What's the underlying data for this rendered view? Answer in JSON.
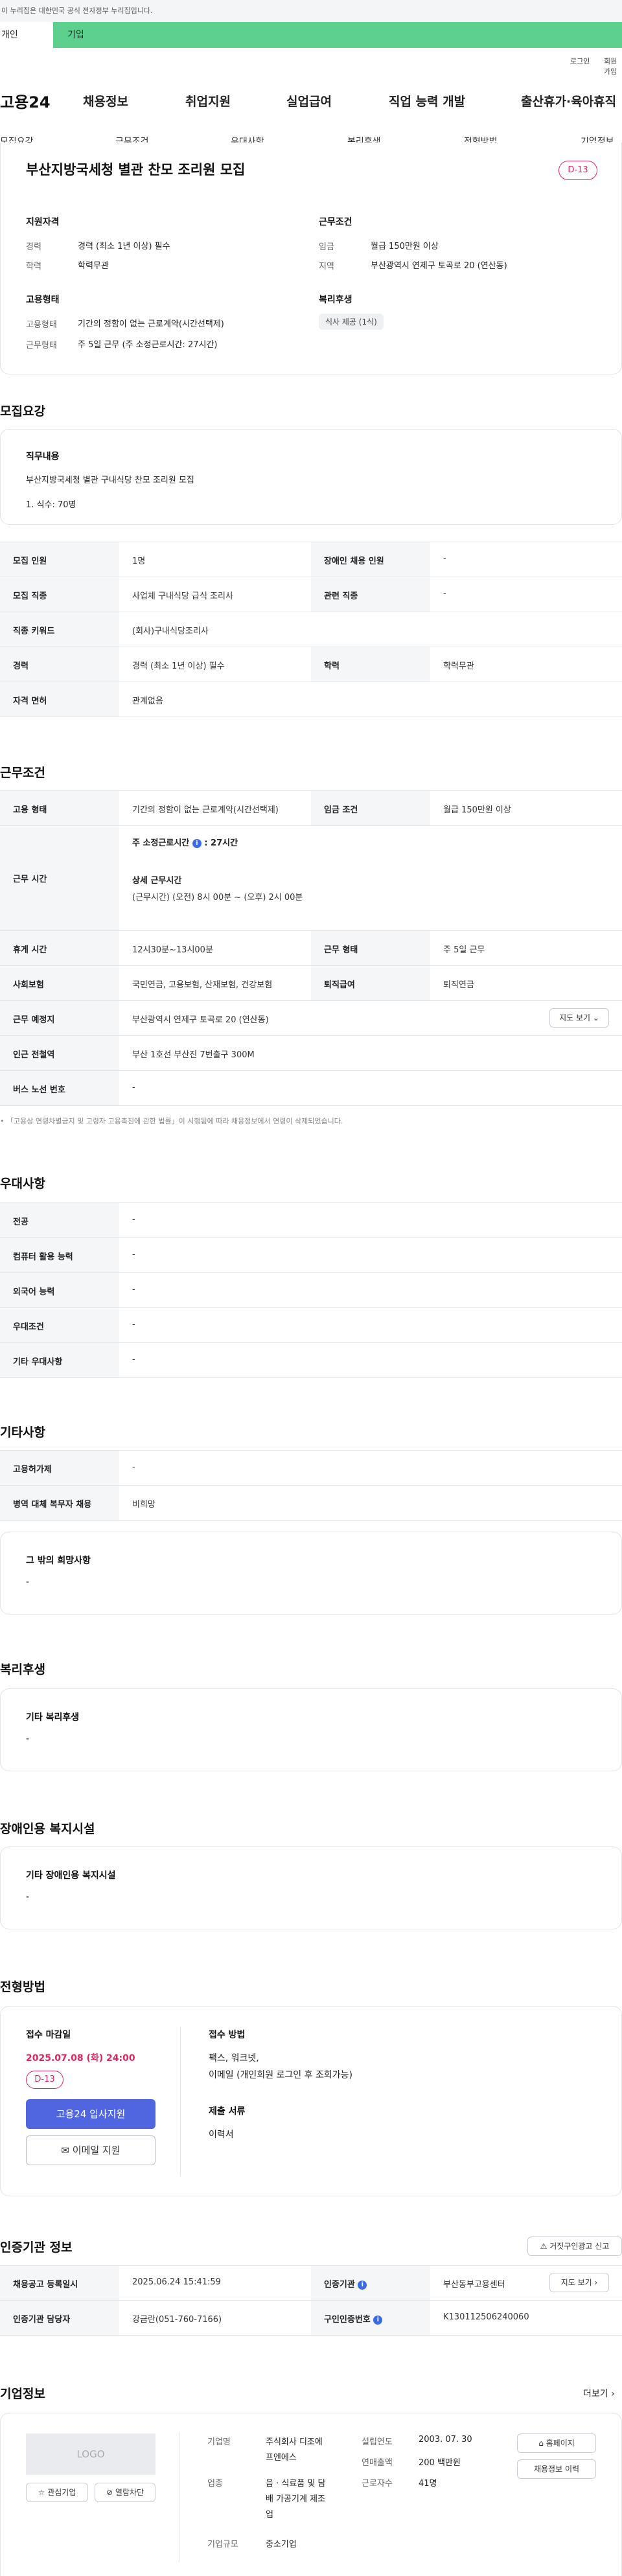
{
  "gov_bar": {
    "text": "이 누리집은 대한민국 공식 전자정부 누리집입니다."
  },
  "top_tabs": {
    "individual": "개인",
    "business": "기업"
  },
  "util": {
    "login": "로그인",
    "join": "회원가입"
  },
  "header": {
    "logo": "고용24",
    "gnb": [
      "채용정보",
      "취업지원",
      "실업급여",
      "직업 능력 개발",
      "출산휴가·육아휴직"
    ]
  },
  "lnb": [
    "모집요강",
    "근무조건",
    "우대사항",
    "복리후생",
    "전형방법",
    "기업정보"
  ],
  "summary": {
    "title": "부산지방국세청 별관 찬모 조리원 모집",
    "dday": "D-13",
    "qual_heading": "지원자격",
    "career_label": "경력",
    "career_value": "경력 (최소 1년 이상) 필수",
    "edu_label": "학력",
    "edu_value": "학력무관",
    "emp_heading": "고용형태",
    "emptype_label": "고용형태",
    "emptype_value": "기간의 정함이 없는 근로계약(시간선택제)",
    "worktype_label": "근무형태",
    "worktype_value": "주 5일 근무 (주 소정근로시간: 27시간)",
    "cond_heading": "근무조건",
    "wage_label": "임금",
    "wage_value": "월급 150만원 이상",
    "region_label": "지역",
    "region_value": "부산광역시 연제구 토곡로 20 (연산동)",
    "welfare_heading": "복리후생",
    "welfare_chip": "식사 제공 (1식)"
  },
  "recruit": {
    "section_title": "모집요강",
    "duty_heading": "직무내용",
    "duty_line1": "부산지방국세청 별관 구내식당 찬모 조리원 모집",
    "duty_line2": "1. 식수: 70명",
    "rows": [
      {
        "h1": "모집 인원",
        "v1": "1명",
        "h2": "장애인 채용 인원",
        "v2": "-"
      },
      {
        "h1": "모집 직종",
        "v1": "사업체 구내식당 급식 조리사",
        "h2": "관련 직종",
        "v2": "-"
      },
      {
        "h1": "직종 키워드",
        "v1": "(회사)구내식당조리사"
      },
      {
        "h1": "경력",
        "v1": "경력 (최소 1년 이상) 필수",
        "h2": "학력",
        "v2": "학력무관"
      },
      {
        "h1": "자격 면허",
        "v1": "관계없음"
      }
    ]
  },
  "work": {
    "section_title": "근무조건",
    "emp_h": "고용 형태",
    "emp_v": "기간의 정함이 없는 근로계약(시간선택제)",
    "wage_h": "임금 조건",
    "wage_v": "월급 150만원 이상",
    "time_h": "근무 시간",
    "time_weekly": "주 소정근로시간",
    "time_weekly_val": ": 27시간",
    "time_detail_title": "상세 근무시간",
    "time_detail": "(근무시간) (오전) 8시 00분 ~ (오후) 2시 00분",
    "rest_h": "휴게 시간",
    "rest_v": "12시30분~13시00분",
    "worktype_h": "근무 형태",
    "worktype_v": "주 5일 근무",
    "ins_h": "사회보험",
    "ins_v": "국민연금, 고용보험, 산재보험, 건강보험",
    "retire_h": "퇴직급여",
    "retire_v": "퇴직연금",
    "place_h": "근무 예정지",
    "place_v": "부산광역시 연제구 토곡로 20 (연산동)",
    "map_btn": "지도 보기",
    "subway_h": "인근 전철역",
    "subway_v": "부산 1호선 부산진 7번출구 300M",
    "bus_h": "버스 노선 번호",
    "bus_v": "-",
    "note": "「고용상 연령차별금지 및 고령자 고용촉진에 관한 법률」이 시행됨에 따라 채용정보에서 연령이 삭제되었습니다."
  },
  "prefer": {
    "section_title": "우대사항",
    "rows": [
      {
        "h": "전공",
        "v": "-"
      },
      {
        "h": "컴퓨터 활용 능력",
        "v": "-"
      },
      {
        "h": "외국어 능력",
        "v": "-"
      },
      {
        "h": "우대조건",
        "v": "-"
      },
      {
        "h": "기타 우대사항",
        "v": "-"
      }
    ]
  },
  "etc": {
    "section_title": "기타사항",
    "rows": [
      {
        "h": "고용허가제",
        "v": "-"
      },
      {
        "h": "병역 대체 복무자 채용",
        "v": "비희망"
      }
    ],
    "box_title": "그 밖의 희망사항",
    "box_value": "-"
  },
  "welfare": {
    "section_title": "복리후생",
    "box_title": "기타 복리후생",
    "box_value": "-"
  },
  "disabled": {
    "section_title": "장애인용 복지시설",
    "box_title": "기타 장애인용 복지시설",
    "box_value": "-"
  },
  "apply": {
    "section_title": "전형방법",
    "deadline_label": "접수 마감일",
    "deadline": "2025.07.08 (화) 24:00",
    "dday": "D-13",
    "apply_btn": "고용24 입사지원",
    "email_btn": "이메일 지원",
    "method_label": "접수 방법",
    "method_line1": "팩스, 워크넷,",
    "method_line2": "이메일 (개인회원 로그인 후 조회가능)",
    "docs_label": "제출 서류",
    "docs_value": "이력서"
  },
  "agency": {
    "section_title": "인증기관 정보",
    "report_btn": "거짓구인광고 신고",
    "reg_h": "채용공고 등록일시",
    "reg_v": "2025.06.24 15:41:59",
    "org_h": "인증기관",
    "org_v": "부산동부고용센터",
    "map_btn": "지도 보기",
    "mgr_h": "인증기관 담당자",
    "mgr_v": "강금란(051-760-7166)",
    "no_h": "구인인증번호",
    "no_v": "K130112506240060"
  },
  "company": {
    "section_title": "기업정보",
    "more": "더보기",
    "logo_text": "LOGO",
    "fav_btn": "관심기업",
    "block_btn": "열람차단",
    "name_label": "기업명",
    "name_value_1": "주식회사 디조에",
    "name_value_2": "프엔에스",
    "industry_label": "업종",
    "industry_value_1": "음 · 식료품 및 담",
    "industry_value_2": "배 가공기계 제조",
    "industry_value_3": "업",
    "size_label": "기업규모",
    "size_value": "중소기업",
    "founded_label": "설립연도",
    "founded_value": "2003. 07. 30",
    "sales_label": "연매출액",
    "sales_value": "200 백만원",
    "staff_label": "근로자수",
    "staff_value": "41명",
    "home_btn": "홈페이지",
    "history_btn": "채용정보 이력"
  },
  "colors": {
    "accent": "#3a6ae6",
    "dday": "#e0245e",
    "biz_tab": "#5ed08d",
    "apply_btn": "#4f66e0"
  }
}
